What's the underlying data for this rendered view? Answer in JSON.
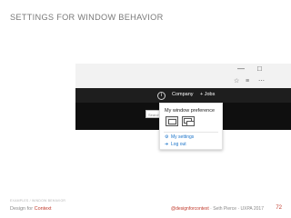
{
  "slide": {
    "title": "SETTINGS FOR WINDOW BEHAVIOR",
    "footer_small": "EXAMPLES / WINDOW BEHAVIOR",
    "footer_left_brand": "Design for ",
    "footer_left_accent": "Context",
    "footer_right_handle": "@designforcontext",
    "footer_right_rest": " · Seth Pierce · UXPA 2017",
    "page_number": "72"
  },
  "browser": {
    "window_controls": [
      "—",
      "□"
    ],
    "toolbar_icons": [
      "☆",
      "≡",
      "⋯"
    ],
    "site_nav": {
      "info_glyph": "i",
      "company_label": "Company",
      "jobs_label": "+ Jobs"
    },
    "search_placeholder": "Search"
  },
  "popup": {
    "title": "My window preference",
    "options": [
      "single-window",
      "multi-window"
    ],
    "menu": [
      {
        "icon": "gear-icon",
        "glyph": "⚙",
        "label": "My settings"
      },
      {
        "icon": "logout-icon",
        "glyph": "➜",
        "label": "Log out"
      }
    ]
  },
  "colors": {
    "accent": "#c0392b",
    "link": "#1a73c9",
    "site_bar": "#1e1e1e"
  }
}
